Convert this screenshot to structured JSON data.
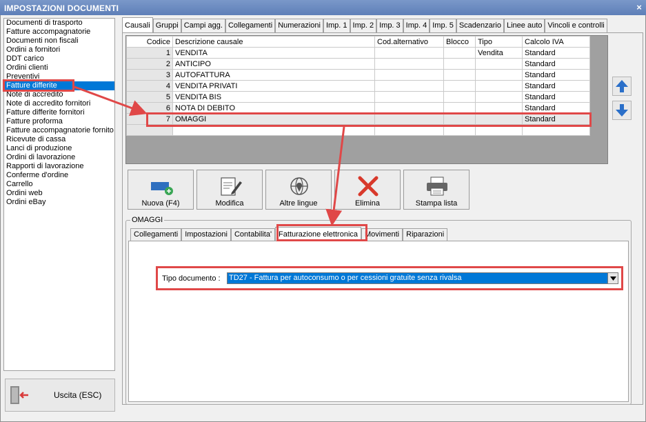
{
  "window": {
    "title": "IMPOSTAZIONI DOCUMENTI",
    "close_glyph": "×"
  },
  "left_list": [
    "Documenti di trasporto",
    "Fatture accompagnatorie",
    "Documenti non fiscali",
    "Ordini a fornitori",
    "DDT carico",
    "Ordini clienti",
    "Preventivi",
    "Fatture differite",
    "Note di accredito",
    "Note di accredito fornitori",
    "Fatture differite fornitori",
    "Fatture proforma",
    "Fatture accompagnatorie fornito",
    "Ricevute di cassa",
    "Lanci di produzione",
    "Ordini di lavorazione",
    "Rapporti di lavorazione",
    "Conferme d'ordine",
    "Carrello",
    "Ordini web",
    "Ordini eBay"
  ],
  "left_selected_index": 7,
  "exit_button": {
    "label": "Uscita (ESC)",
    "icon": "exit-door-icon"
  },
  "tabs": [
    "Causali",
    "Gruppi",
    "Campi agg.",
    "Collegamenti",
    "Numerazioni",
    "Imp. 1",
    "Imp. 2",
    "Imp. 3",
    "Imp. 4",
    "Imp. 5",
    "Scadenzario",
    "Linee auto",
    "Vincoli e controlli"
  ],
  "active_tab": "Causali",
  "grid": {
    "columns": [
      "Codice",
      "Descrizione causale",
      "Cod.alternativo",
      "Blocco",
      "Tipo",
      "Calcolo IVA"
    ],
    "rows": [
      {
        "code": "1",
        "desc": "VENDITA",
        "alt": "",
        "block": "",
        "type": "Vendita",
        "iva": "Standard"
      },
      {
        "code": "2",
        "desc": "ANTICIPO",
        "alt": "",
        "block": "",
        "type": "",
        "iva": "Standard"
      },
      {
        "code": "3",
        "desc": "AUTOFATTURA",
        "alt": "",
        "block": "",
        "type": "",
        "iva": "Standard"
      },
      {
        "code": "4",
        "desc": "VENDITA PRIVATI",
        "alt": "",
        "block": "",
        "type": "",
        "iva": "Standard"
      },
      {
        "code": "5",
        "desc": "VENDITA BIS",
        "alt": "",
        "block": "",
        "type": "",
        "iva": "Standard"
      },
      {
        "code": "6",
        "desc": "NOTA DI DEBITO",
        "alt": "",
        "block": "",
        "type": "",
        "iva": "Standard"
      },
      {
        "code": "7",
        "desc": "OMAGGI",
        "alt": "",
        "block": "",
        "type": "",
        "iva": "Standard"
      }
    ],
    "selected_code": "7"
  },
  "side_arrows": {
    "up_icon": "arrow-up-icon",
    "down_icon": "arrow-down-icon",
    "color": "#2a6fc9"
  },
  "toolbar": [
    {
      "id": "nuova",
      "label": "Nuova (F4)",
      "icon": "add-card-icon"
    },
    {
      "id": "modifica",
      "label": "Modifica",
      "icon": "edit-document-icon"
    },
    {
      "id": "altre-lingue",
      "label": "Altre lingue",
      "icon": "globe-pin-icon"
    },
    {
      "id": "elimina",
      "label": "Elimina",
      "icon": "delete-x-icon"
    },
    {
      "id": "stampa",
      "label": "Stampa lista",
      "icon": "printer-icon"
    }
  ],
  "detail": {
    "group_title": "OMAGGI",
    "subtabs": [
      "Collegamenti",
      "Impostazioni",
      "Contabilita'",
      "Fatturazione elettronica",
      "Movimenti",
      "Riparazioni"
    ],
    "active_subtab": "Fatturazione elettronica",
    "tipo_documento": {
      "label": "Tipo documento :",
      "value": "TD27 - Fattura per autoconsumo o per cessioni gratuite senza rivalsa"
    }
  },
  "colors": {
    "highlight": "#e04848",
    "selection": "#0078d7",
    "titlebar": "#6a8bc0"
  }
}
